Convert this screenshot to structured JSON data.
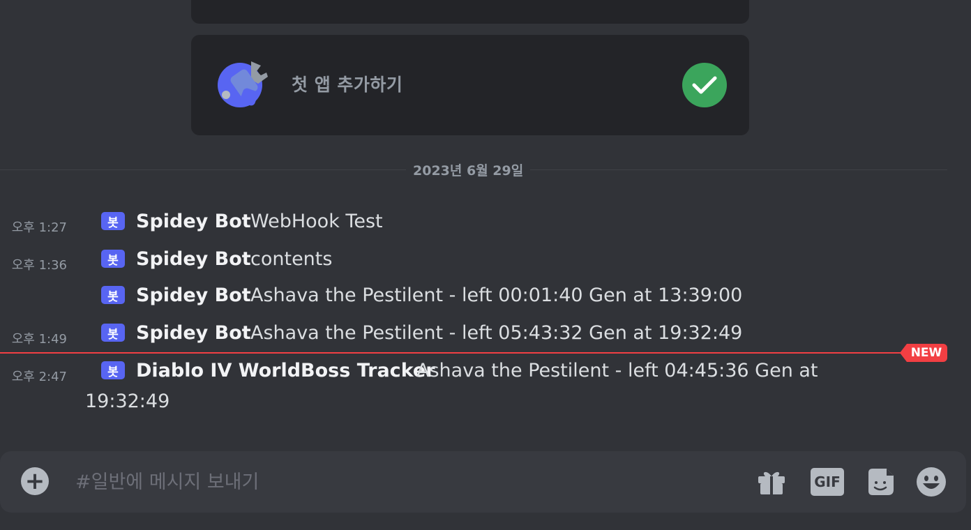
{
  "onboarding": {
    "task_label": "첫 앱 추가하기",
    "completed": true
  },
  "date_divider": "2023년 6월 29일",
  "messages": [
    {
      "time": "오후 1:27",
      "bot_tag": "봇",
      "author": "Spidey Bot",
      "content": "WebHook Test"
    },
    {
      "time": "오후 1:36",
      "bot_tag": "봇",
      "author": "Spidey Bot",
      "content": "contents"
    },
    {
      "time": "",
      "bot_tag": "봇",
      "author": "Spidey Bot",
      "content": "Ashava the Pestilent - left 00:01:40 Gen at 13:39:00"
    },
    {
      "time": "오후 1:49",
      "bot_tag": "봇",
      "author": "Spidey Bot",
      "content": "Ashava the Pestilent - left 05:43:32 Gen at 19:32:49"
    },
    {
      "time": "오후 2:47",
      "bot_tag": "봇",
      "author": "Diablo IV WorldBoss Tracker",
      "content": "Ashava the Pestilent - left 04:45:36 Gen at",
      "content_cont": "19:32:49"
    }
  ],
  "new_marker": "NEW",
  "composer": {
    "placeholder": "#일반에 메시지 보내기",
    "gif_label": "GIF"
  },
  "colors": {
    "background": "#313338",
    "card": "#232428",
    "bot_badge": "#5865f2",
    "check": "#3ba55c",
    "new_marker": "#f23f43"
  },
  "icons": [
    "add-app-icon",
    "checkmark-icon",
    "plus-icon",
    "gift-icon",
    "gif-icon",
    "sticker-icon",
    "emoji-icon"
  ]
}
